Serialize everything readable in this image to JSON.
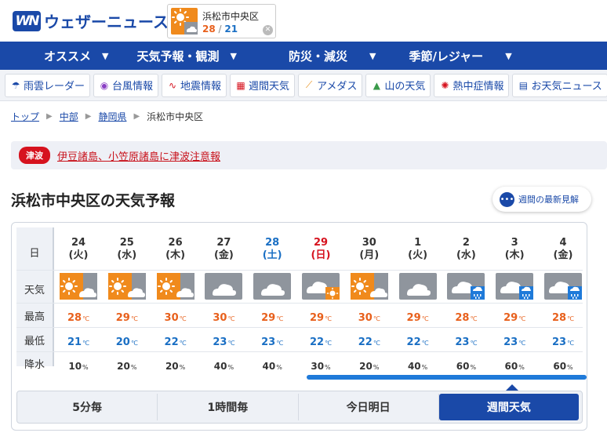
{
  "header": {
    "logo_mark": "WN",
    "logo_text": "ウェザーニュース",
    "location": {
      "name": "浜松市中央区",
      "high": "28",
      "low": "21",
      "sep": " / ",
      "icon": "sun-cloud-icon"
    }
  },
  "nav": [
    {
      "label": "オススメ",
      "arrow": "▼"
    },
    {
      "label": "天気予報・観測",
      "arrow": "▼"
    },
    {
      "label": "防災・減災",
      "arrow": "▼"
    },
    {
      "label": "季節/レジャー",
      "arrow": "▼"
    }
  ],
  "subnav": [
    {
      "label": "雨雲レーダー",
      "icon": "umbrella-icon",
      "color": "#1a49a8"
    },
    {
      "label": "台風情報",
      "icon": "typhoon-icon",
      "color": "#8a3fc4"
    },
    {
      "label": "地震情報",
      "icon": "seismic-wave-icon",
      "color": "#d6121e"
    },
    {
      "label": "週間天気",
      "icon": "calendar-icon",
      "color": "#d6121e"
    },
    {
      "label": "アメダス",
      "icon": "chart-line-icon",
      "color": "#e8901c"
    },
    {
      "label": "山の天気",
      "icon": "mountain-icon",
      "color": "#3a9a4a"
    },
    {
      "label": "熱中症情報",
      "icon": "sun-burst-icon",
      "color": "#d6121e"
    },
    {
      "label": "お天気ニュース",
      "icon": "news-icon",
      "color": "#1a49a8"
    }
  ],
  "breadcrumb": {
    "items": [
      "トップ",
      "中部",
      "静岡県"
    ],
    "current": "浜松市中央区"
  },
  "alert": {
    "badge": "津波",
    "text": "伊豆諸島、小笠原諸島に津波注意報"
  },
  "title": "浜松市中央区の天気予報",
  "latest_button": {
    "label": "週間の最新見解",
    "icon": "chat-bubble-icon"
  },
  "forecast": {
    "row_labels": {
      "day": "日",
      "weather": "天気",
      "high": "最高",
      "low": "最低",
      "rain": "降水"
    },
    "temp_unit": "℃",
    "rain_unit": "%",
    "days": [
      {
        "date": "24",
        "dow": "(火)",
        "type": "weekday",
        "weather": "sun-cloud",
        "high": "28",
        "low": "21",
        "rain": "10"
      },
      {
        "date": "25",
        "dow": "(水)",
        "type": "weekday",
        "weather": "sun-cloud",
        "high": "29",
        "low": "20",
        "rain": "20"
      },
      {
        "date": "26",
        "dow": "(木)",
        "type": "weekday",
        "weather": "sun-cloud",
        "high": "30",
        "low": "22",
        "rain": "20"
      },
      {
        "date": "27",
        "dow": "(金)",
        "type": "weekday",
        "weather": "cloud",
        "high": "30",
        "low": "23",
        "rain": "40"
      },
      {
        "date": "28",
        "dow": "(土)",
        "type": "sat",
        "weather": "cloud",
        "high": "29",
        "low": "23",
        "rain": "40"
      },
      {
        "date": "29",
        "dow": "(日)",
        "type": "sun",
        "weather": "cloud-sun",
        "high": "29",
        "low": "22",
        "rain": "30"
      },
      {
        "date": "30",
        "dow": "(月)",
        "type": "weekday",
        "weather": "sun-cloud",
        "high": "30",
        "low": "22",
        "rain": "20"
      },
      {
        "date": "1",
        "dow": "(火)",
        "type": "weekday",
        "weather": "cloud",
        "high": "29",
        "low": "22",
        "rain": "40"
      },
      {
        "date": "2",
        "dow": "(水)",
        "type": "weekday",
        "weather": "cloud-rain",
        "high": "28",
        "low": "23",
        "rain": "60"
      },
      {
        "date": "3",
        "dow": "(木)",
        "type": "weekday",
        "weather": "cloud-rain",
        "high": "29",
        "low": "23",
        "rain": "60"
      },
      {
        "date": "4",
        "dow": "(金)",
        "type": "weekday",
        "weather": "cloud-rain",
        "high": "28",
        "low": "23",
        "rain": "60"
      }
    ],
    "tabs": [
      {
        "label": "5分毎",
        "active": false
      },
      {
        "label": "1時間毎",
        "active": false
      },
      {
        "label": "今日明日",
        "active": false
      },
      {
        "label": "週間天気",
        "active": true
      }
    ]
  },
  "colors": {
    "brand": "#1a49a8",
    "high": "#e8601c",
    "low": "#1a6fc4",
    "sun_bg": "#f08a1c",
    "cloud_bg": "#8f959d",
    "alert": "#d6121e"
  }
}
